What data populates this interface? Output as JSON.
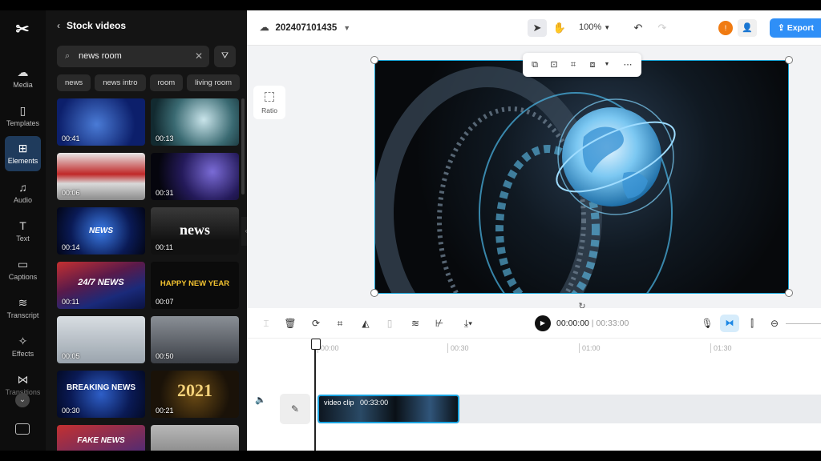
{
  "app": {
    "logo": "✂"
  },
  "rail": {
    "items": [
      {
        "label": "Media",
        "icon": "media-icon"
      },
      {
        "label": "Templates",
        "icon": "templates-icon"
      },
      {
        "label": "Elements",
        "icon": "elements-icon"
      },
      {
        "label": "Audio",
        "icon": "audio-icon"
      },
      {
        "label": "Text",
        "icon": "text-icon"
      },
      {
        "label": "Captions",
        "icon": "captions-icon"
      },
      {
        "label": "Transcript",
        "icon": "transcript-icon"
      },
      {
        "label": "Effects",
        "icon": "effects-icon"
      },
      {
        "label": "Transitions",
        "icon": "transitions-icon"
      }
    ],
    "active": "Elements"
  },
  "panel": {
    "title": "Stock videos",
    "search_value": "news room",
    "chips": [
      "news",
      "news intro",
      "room",
      "living room"
    ],
    "thumbs": [
      {
        "duration": "00:41",
        "caption": ""
      },
      {
        "duration": "00:13",
        "caption": ""
      },
      {
        "duration": "00:06",
        "caption": ""
      },
      {
        "duration": "00:31",
        "caption": ""
      },
      {
        "duration": "00:14",
        "caption": "NEWS"
      },
      {
        "duration": "00:11",
        "caption": "news"
      },
      {
        "duration": "00:11",
        "caption": "24/7 NEWS"
      },
      {
        "duration": "00:07",
        "caption": "HAPPY NEW YEAR"
      },
      {
        "duration": "00:05",
        "caption": ""
      },
      {
        "duration": "00:50",
        "caption": ""
      },
      {
        "duration": "00:30",
        "caption": "BREAKING NEWS"
      },
      {
        "duration": "00:21",
        "caption": "2021"
      },
      {
        "duration": "",
        "caption": "FAKE NEWS"
      },
      {
        "duration": "",
        "caption": ""
      }
    ]
  },
  "editor": {
    "project_name": "202407101435",
    "zoom": "100%",
    "avatar_initial": "!",
    "export_label": "Export",
    "ratio_label": "Ratio"
  },
  "timeline": {
    "current": "00:00:00",
    "separator": "|",
    "total": "00:33:00",
    "ruler": [
      "00:00",
      "00:30",
      "01:00",
      "01:30"
    ],
    "clip_label": "video clip",
    "clip_duration": "00:33:00"
  },
  "colors": {
    "accent": "#2f8ff7",
    "selection": "#18a6d9",
    "panel_bg": "#141414"
  }
}
